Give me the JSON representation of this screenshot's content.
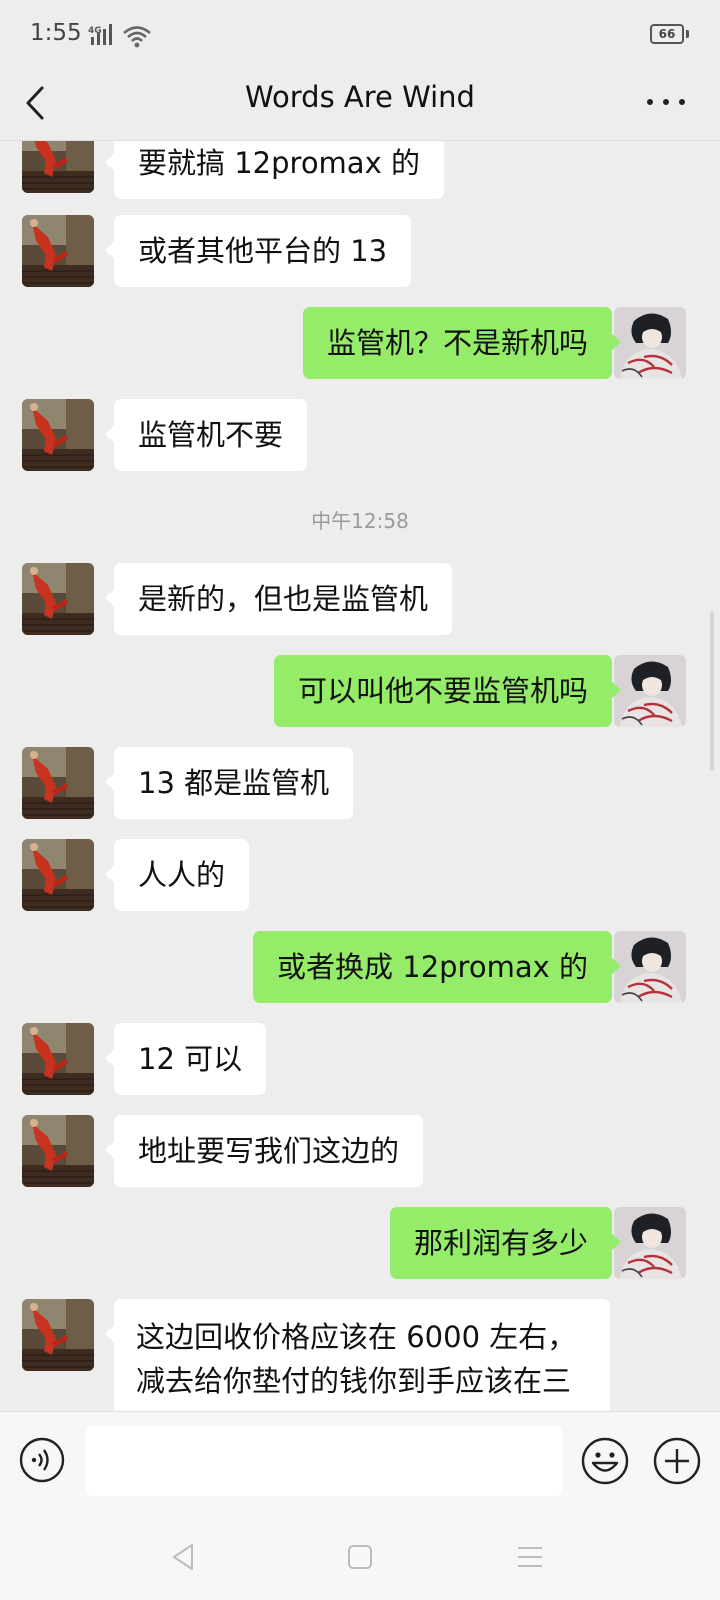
{
  "status_bar": {
    "time": "1:55",
    "network": "4G",
    "battery": "66"
  },
  "header": {
    "title": "Words Are Wind",
    "back_icon": "chevron-left-icon",
    "more_icon": "more-dots-icon"
  },
  "messages": [
    {
      "side": "in",
      "text": "要就搞 12promax 的"
    },
    {
      "side": "in",
      "text": "或者其他平台的 13"
    },
    {
      "side": "out",
      "text": "监管机？不是新机吗"
    },
    {
      "side": "in",
      "text": "监管机不要"
    },
    {
      "type": "time",
      "text": "中午12:58"
    },
    {
      "side": "in",
      "text": "是新的，但也是监管机"
    },
    {
      "side": "out",
      "text": "可以叫他不要监管机吗"
    },
    {
      "side": "in",
      "text": "13 都是监管机"
    },
    {
      "side": "in",
      "text": "人人的"
    },
    {
      "side": "out",
      "text": "或者换成 12promax 的"
    },
    {
      "side": "in",
      "text": "12 可以"
    },
    {
      "side": "in",
      "text": "地址要写我们这边的"
    },
    {
      "side": "out",
      "text": "那利润有多少"
    },
    {
      "side": "in",
      "line1": "这边回收价格应该在 6000 左右，",
      "line2": "减去给你垫付的钱你到手应该在三"
    }
  ],
  "input": {
    "placeholder": ""
  },
  "colors": {
    "background": "#ededed",
    "outgoing_bubble": "#95ec69",
    "incoming_bubble": "#ffffff"
  }
}
